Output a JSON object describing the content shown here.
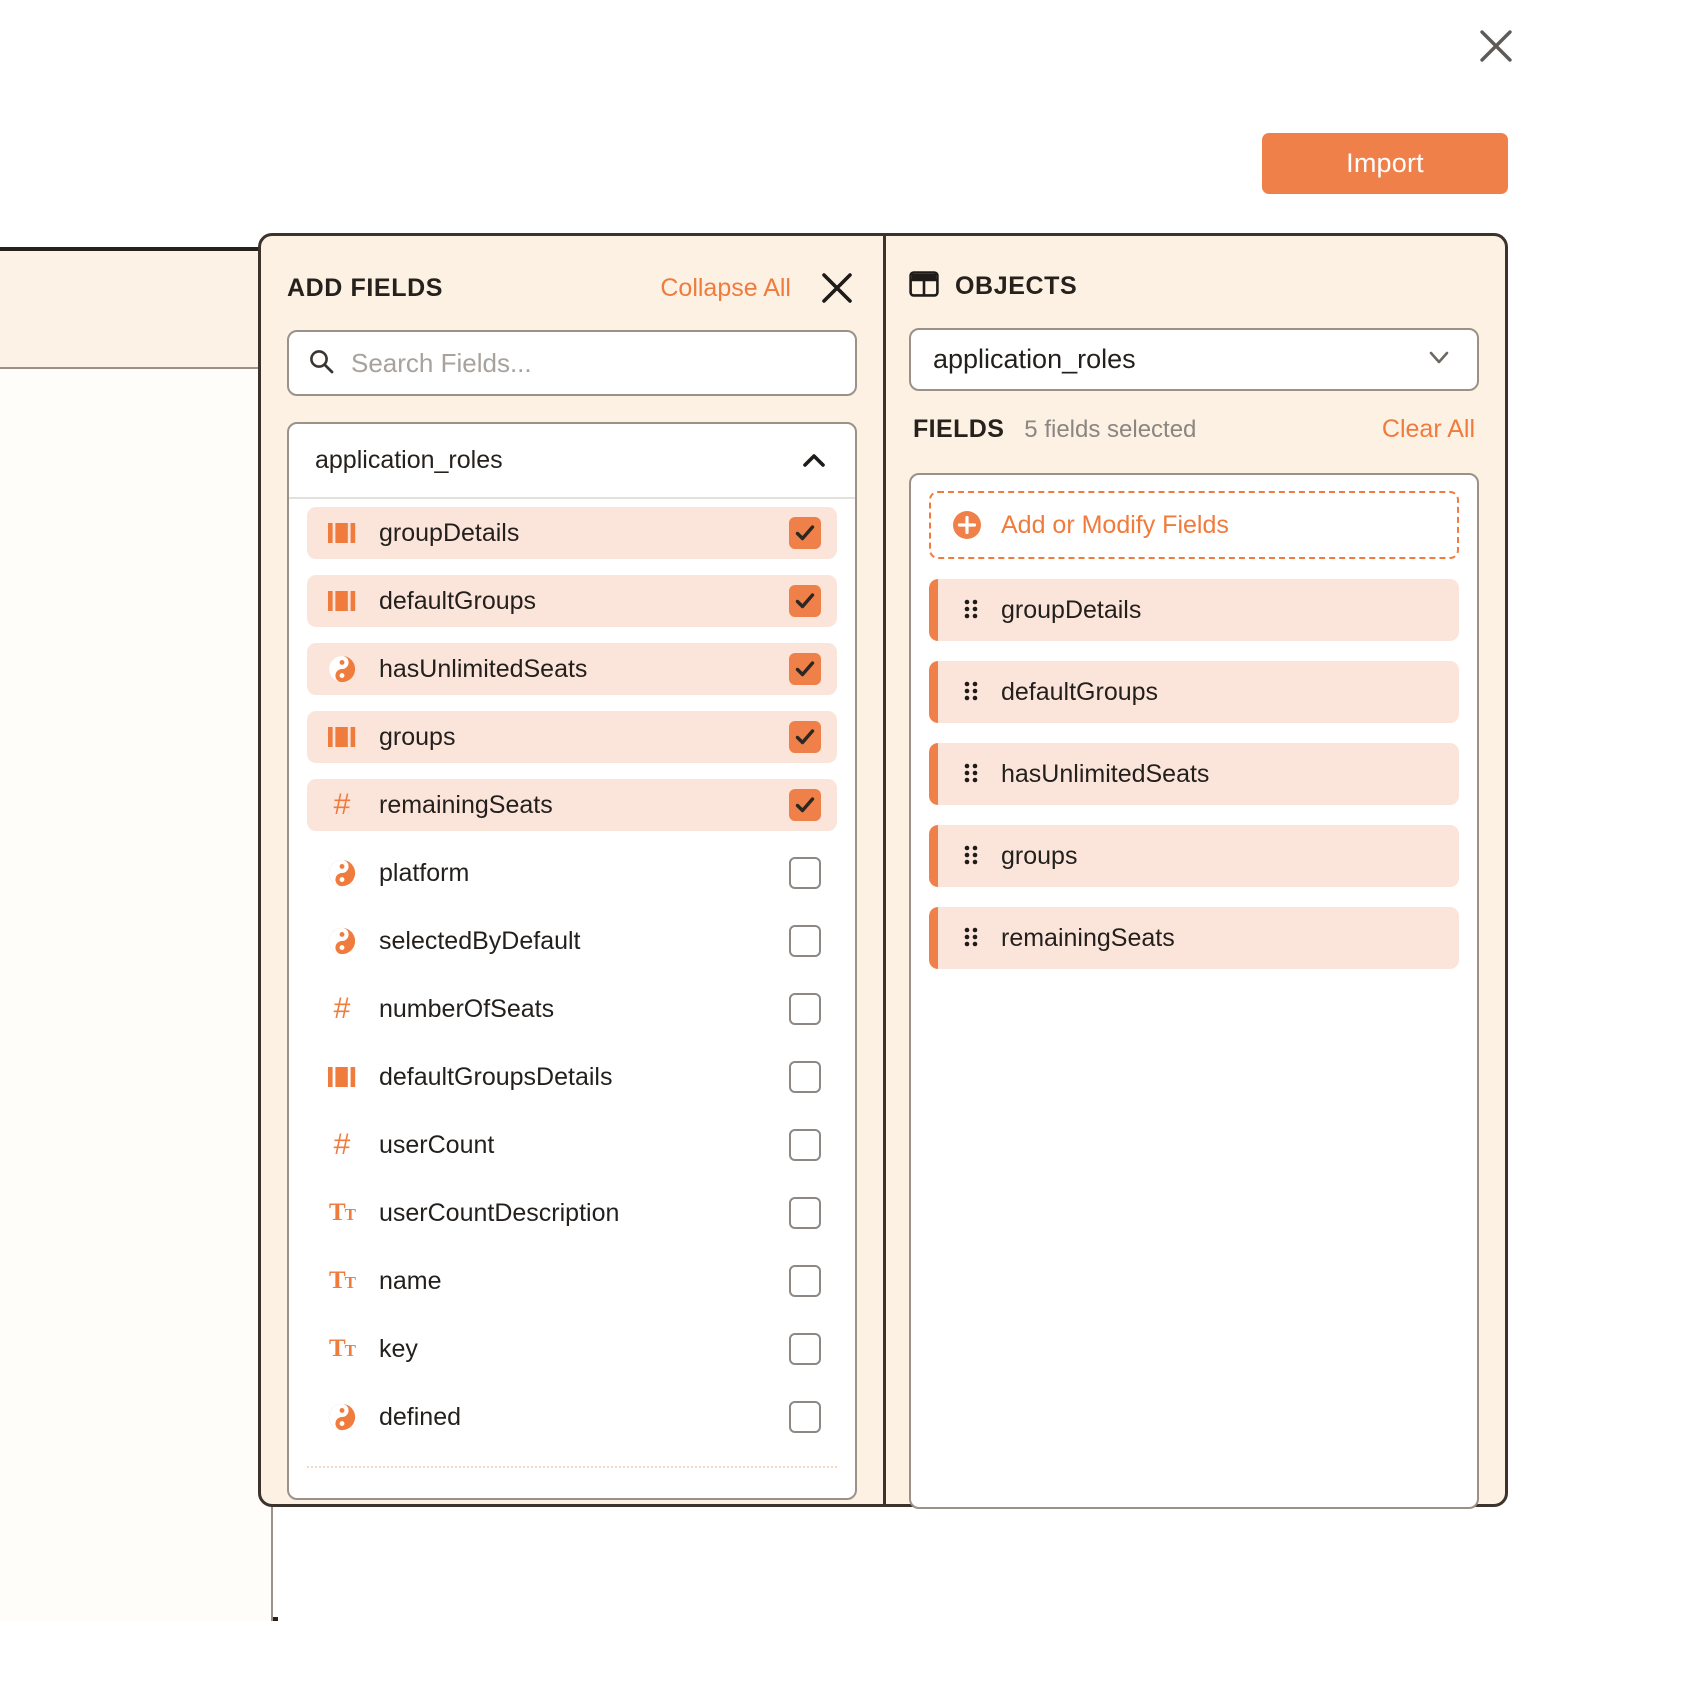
{
  "theme": {
    "accent": "#ef7b3c",
    "accent_fill": "#ef8049",
    "row_selected_bg": "#fbe5da",
    "panel_bg": "#fdf1e4",
    "border_dark": "#3b332c"
  },
  "topbar": {
    "close_icon": "close-icon",
    "import_label": "Import"
  },
  "add_fields": {
    "title": "ADD FIELDS",
    "collapse_all_label": "Collapse All",
    "close_icon": "close-icon",
    "search": {
      "icon": "search-icon",
      "placeholder": "Search Fields...",
      "value": ""
    },
    "group": {
      "name": "application_roles",
      "chevron_icon": "chevron-up-icon",
      "expanded": true
    },
    "fields": [
      {
        "label": "groupDetails",
        "type": "array",
        "checked": true
      },
      {
        "label": "defaultGroups",
        "type": "array",
        "checked": true
      },
      {
        "label": "hasUnlimitedSeats",
        "type": "boolean",
        "checked": true
      },
      {
        "label": "groups",
        "type": "array",
        "checked": true
      },
      {
        "label": "remainingSeats",
        "type": "number",
        "checked": true
      },
      {
        "label": "platform",
        "type": "boolean",
        "checked": false
      },
      {
        "label": "selectedByDefault",
        "type": "boolean",
        "checked": false
      },
      {
        "label": "numberOfSeats",
        "type": "number",
        "checked": false
      },
      {
        "label": "defaultGroupsDetails",
        "type": "array",
        "checked": false
      },
      {
        "label": "userCount",
        "type": "number",
        "checked": false
      },
      {
        "label": "userCountDescription",
        "type": "text",
        "checked": false
      },
      {
        "label": "name",
        "type": "text",
        "checked": false
      },
      {
        "label": "key",
        "type": "text",
        "checked": false
      },
      {
        "label": "defined",
        "type": "boolean",
        "checked": false
      }
    ]
  },
  "objects": {
    "title": "OBJECTS",
    "title_icon": "table-icon",
    "select": {
      "value": "application_roles",
      "chevron_icon": "chevron-down-icon"
    },
    "fields_label": "FIELDS",
    "selected_count_text": "5 fields selected",
    "clear_all_label": "Clear All",
    "add_modify_label": "Add or Modify Fields",
    "add_modify_icon": "plus-circle-icon",
    "selected_fields": [
      {
        "label": "groupDetails",
        "drag_icon": "drag-handle-icon"
      },
      {
        "label": "defaultGroups",
        "drag_icon": "drag-handle-icon"
      },
      {
        "label": "hasUnlimitedSeats",
        "drag_icon": "drag-handle-icon"
      },
      {
        "label": "groups",
        "drag_icon": "drag-handle-icon"
      },
      {
        "label": "remainingSeats",
        "drag_icon": "drag-handle-icon"
      }
    ]
  }
}
